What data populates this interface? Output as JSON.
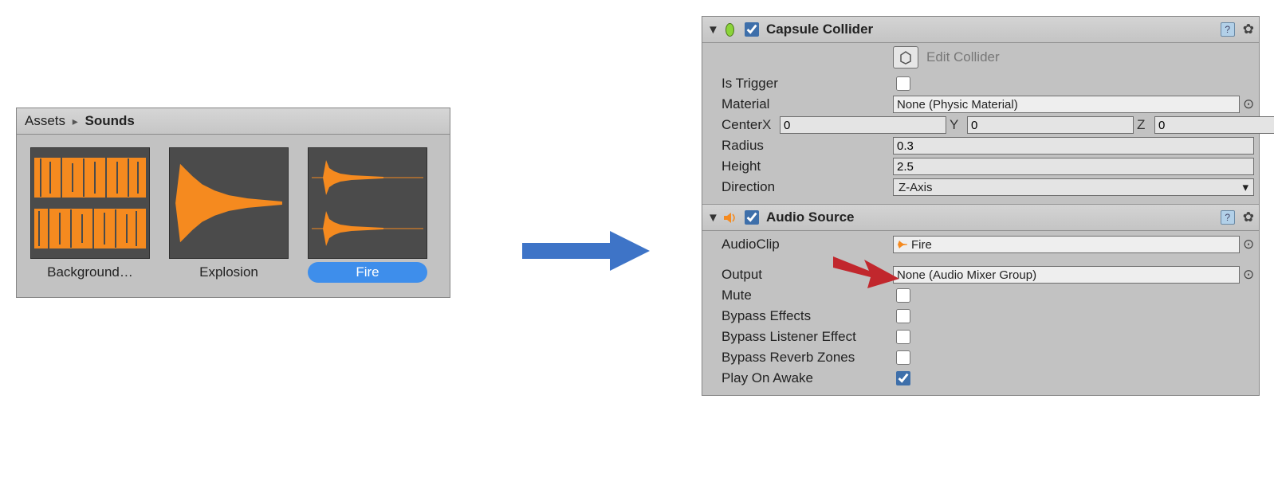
{
  "assets": {
    "breadcrumb_root": "Assets",
    "breadcrumb_folder": "Sounds",
    "items": [
      {
        "label": "Background…"
      },
      {
        "label": "Explosion"
      },
      {
        "label": "Fire"
      }
    ],
    "selected_index": 2
  },
  "capsule": {
    "title": "Capsule Collider",
    "edit_label": "Edit Collider",
    "is_trigger_label": "Is Trigger",
    "is_trigger": false,
    "material_label": "Material",
    "material_value": "None (Physic Material)",
    "center_label": "Center",
    "center": {
      "x": "0",
      "y": "0",
      "z": "0"
    },
    "radius_label": "Radius",
    "radius": "0.3",
    "height_label": "Height",
    "height": "2.5",
    "direction_label": "Direction",
    "direction": "Z-Axis"
  },
  "audio": {
    "title": "Audio Source",
    "clip_label": "AudioClip",
    "clip_value": "Fire",
    "output_label": "Output",
    "output_value": "None (Audio Mixer Group)",
    "mute_label": "Mute",
    "mute": false,
    "bypass_effects_label": "Bypass Effects",
    "bypass_effects": false,
    "bypass_listener_label": "Bypass Listener Effect",
    "bypass_listener": false,
    "bypass_reverb_label": "Bypass Reverb Zones",
    "bypass_reverb": false,
    "play_on_awake_label": "Play On Awake",
    "play_on_awake": true
  }
}
